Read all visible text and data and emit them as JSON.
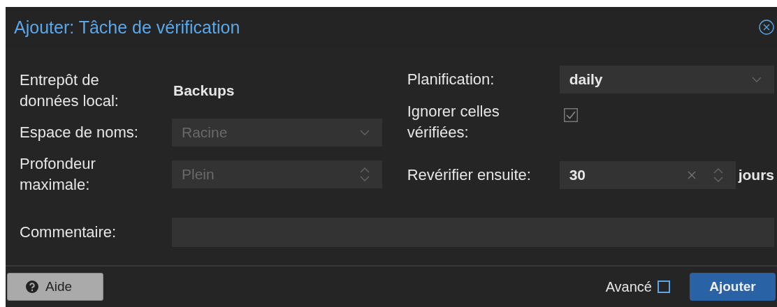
{
  "window": {
    "title": "Ajouter: Tâche de vérification"
  },
  "left_fields": [
    {
      "kind": "display",
      "label": "Entrepôt de données local:",
      "value": "Backups"
    },
    {
      "kind": "combo",
      "label": "Espace de noms:",
      "value": "Racine",
      "disabled": true
    },
    {
      "kind": "spinner",
      "label": "Profondeur maximale:",
      "value": "Plein",
      "disabled": true
    }
  ],
  "right_fields": [
    {
      "kind": "combo",
      "label": "Planification:",
      "value": "daily",
      "disabled": false
    },
    {
      "kind": "checkbox",
      "label": "Ignorer celles vérifiées:",
      "checked": true
    },
    {
      "kind": "number",
      "label": "Revérifier ensuite:",
      "value": "30",
      "unit": "jours"
    }
  ],
  "comment": {
    "label": "Commentaire:"
  },
  "footer": {
    "help_button": "Aide",
    "advanced": {
      "label": "Avancé",
      "checked": false
    },
    "submit_button": "Ajouter"
  }
}
